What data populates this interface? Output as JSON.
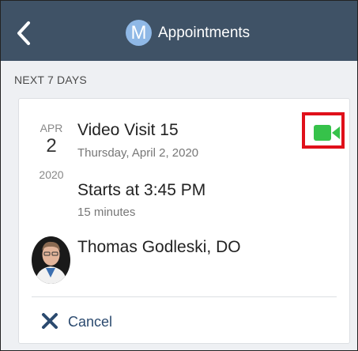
{
  "header": {
    "back_icon": "chevron-left-icon",
    "avatar_letter": "M",
    "title": "Appointments",
    "background_color": "#3f5266"
  },
  "section": {
    "label": "NEXT 7 DAYS"
  },
  "appointment": {
    "month": "APR",
    "day": "2",
    "year": "2020",
    "title": "Video Visit 15",
    "date_long": "Thursday, April 2, 2020",
    "start_time": "Starts at 3:45 PM",
    "duration": "15 minutes",
    "provider_name": "Thomas Godleski, DO",
    "video_icon": "video-camera-icon",
    "video_icon_color": "#36c24a",
    "highlight_color": "#e0101a"
  },
  "actions": {
    "cancel_label": "Cancel",
    "cancel_icon": "close-icon"
  }
}
